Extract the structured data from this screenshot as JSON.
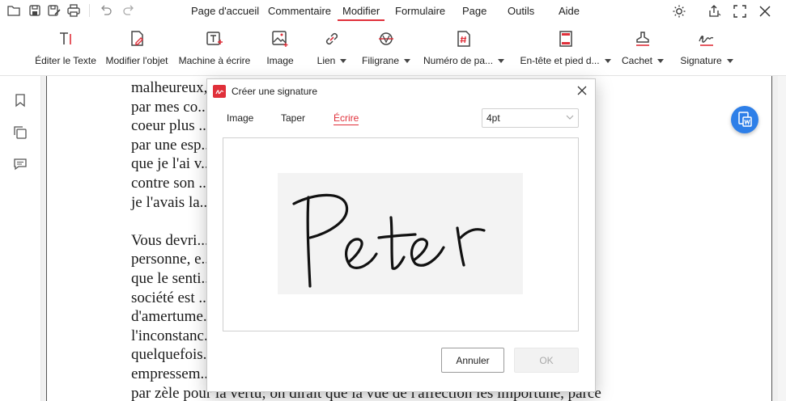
{
  "menu": {
    "items": [
      "Page d'accueil",
      "Commentaire",
      "Modifier",
      "Formulaire",
      "Page",
      "Outils",
      "Aide"
    ],
    "active": "Modifier"
  },
  "ribbon": {
    "edit_text": "Éditer le Texte",
    "edit_object": "Modifier l'objet",
    "typewriter": "Machine à écrire",
    "image": "Image",
    "link": "Lien",
    "watermark": "Filigrane",
    "page_number": "Numéro de pa...",
    "header_footer": "En-tête et pied d...",
    "stamp": "Cachet",
    "signature": "Signature"
  },
  "document": {
    "paragraphs": [
      [
        "malheureux, ... d'arracher",
        "par mes co... et d'un",
        "coeur plus ... , la dominait",
        "par une esp... ernière fois",
        "que je l'ai v... a raison",
        "contre son ... les lieux où",
        "je l'avais la..."
      ],
      [
        "Vous devri... is blesser",
        "personne, e... nore prouve",
        "que le senti... choses. La",
        "société est ... nêle trop",
        "d'amertume... chant à",
        "l'inconstanc... isissent",
        "quelquefois...",
        "empressem... nuisibles",
        "par zèle pour la vertu; on dirait que la vue de l'affection les importune, parce"
      ]
    ]
  },
  "dialog": {
    "title": "Créer une signature",
    "tabs": [
      "Image",
      "Taper",
      "Écrire"
    ],
    "active_tab": "Écrire",
    "pen_size": "4pt",
    "signature_text": "Peter",
    "cancel_label": "Annuler",
    "ok_label": "OK"
  },
  "colors": {
    "accent": "#e0303a",
    "convert_button": "#2e7fe8"
  },
  "icons": {
    "save": "save-icon",
    "save_as": "save-as-icon",
    "print": "print-icon",
    "undo": "undo-icon",
    "redo": "redo-icon",
    "theme": "sun-icon",
    "share": "share-icon",
    "fullscreen": "fullscreen-icon",
    "close": "close-icon",
    "bookmark": "bookmark-icon",
    "pages": "pages-icon",
    "comments": "comment-icon",
    "convert_word": "convert-to-word-icon"
  }
}
